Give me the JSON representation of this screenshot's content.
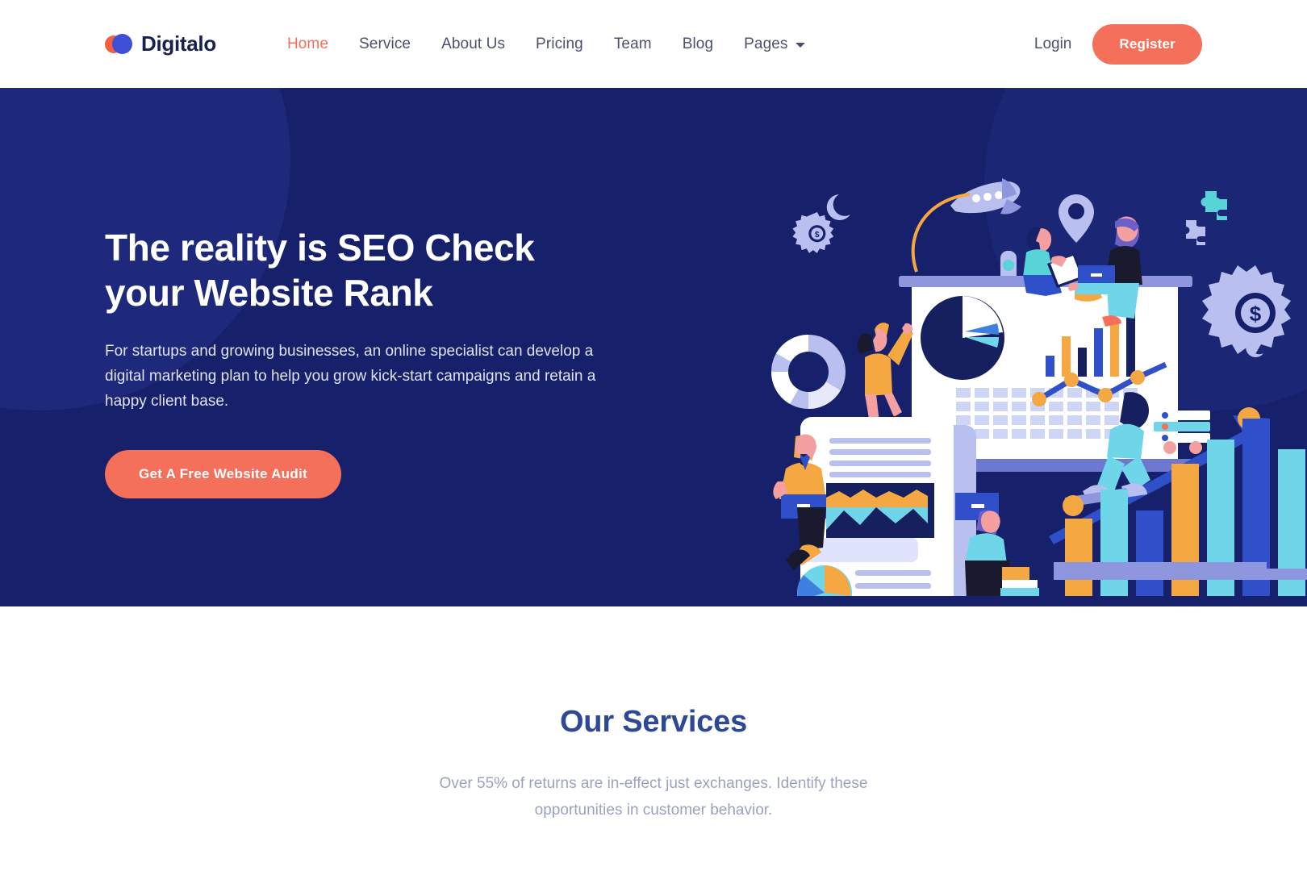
{
  "brand": {
    "name": "Digitalo",
    "mark_colors": {
      "orange": "#f4603e",
      "blue": "#3f4ed6"
    }
  },
  "header": {
    "nav": [
      {
        "label": "Home",
        "active": true,
        "has_dropdown": false
      },
      {
        "label": "Service",
        "active": false,
        "has_dropdown": false
      },
      {
        "label": "About Us",
        "active": false,
        "has_dropdown": false
      },
      {
        "label": "Pricing",
        "active": false,
        "has_dropdown": false
      },
      {
        "label": "Team",
        "active": false,
        "has_dropdown": false
      },
      {
        "label": "Blog",
        "active": false,
        "has_dropdown": false
      },
      {
        "label": "Pages",
        "active": false,
        "has_dropdown": true
      }
    ],
    "login_label": "Login",
    "register_label": "Register"
  },
  "hero": {
    "title": "The reality is SEO Check your Website Rank",
    "paragraph": "For startups and growing businesses, an online specialist can develop a digital marketing plan to help you grow kick-start campaigns and retain a happy client base.",
    "cta_label": "Get A Free Website Audit",
    "background_color": "#17216b",
    "accent_color": "#f4705a"
  },
  "services": {
    "title": "Our Services",
    "subtitle": "Over 55% of returns are in-effect just exchanges. Identify these opportunities in customer behavior.",
    "title_color": "#2d4894"
  },
  "illustration": {
    "alt": "seo-analytics-illustration",
    "elements": [
      "gear-dollar-icon",
      "moon-icon",
      "donut-chart",
      "person-climbing",
      "person-reading-book",
      "rocket-icon",
      "location-pin-icon",
      "puzzle-pieces-icon",
      "person-with-laptop",
      "pie-chart",
      "bar-chart",
      "line-chart",
      "document-area-chart",
      "person-sitting-books",
      "growth-arrow"
    ],
    "chart_colors": {
      "orange": "#f5a742",
      "cyan": "#6fd5e8",
      "blue": "#2f50c8",
      "navy": "#16205f",
      "lavender": "#b7bcec",
      "white": "#ffffff"
    }
  }
}
